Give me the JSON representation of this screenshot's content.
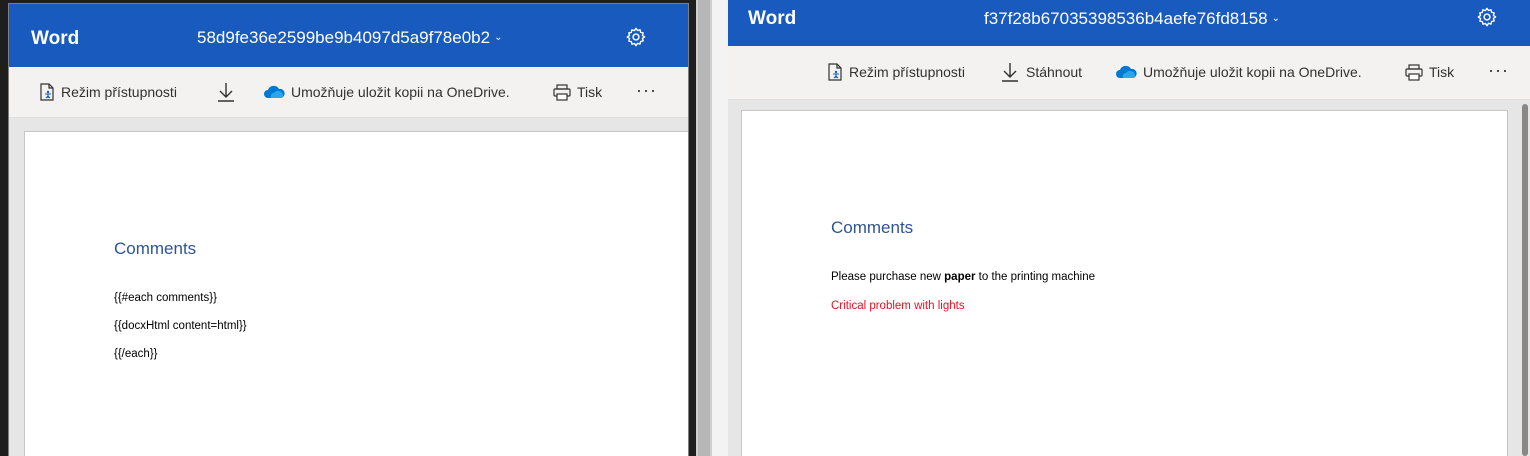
{
  "left": {
    "app_name": "Word",
    "doc_title": "58d9fe36e2599be9b4097d5a9f78e0b2",
    "toolbar": {
      "accessibility_label": "Režim přístupnosti",
      "onedrive_label": "Umožňuje uložit kopii na OneDrive.",
      "print_label": "Tisk",
      "more_label": "···"
    },
    "document": {
      "heading": "Comments",
      "lines": [
        "{{#each comments}}",
        "{{docxHtml content=html}}",
        "{{/each}}"
      ]
    }
  },
  "right": {
    "app_name": "Word",
    "doc_title": "f37f28b67035398536b4aefe76fd8158",
    "toolbar": {
      "accessibility_label": "Režim přístupnosti",
      "download_label": "Stáhnout",
      "onedrive_label": "Umožňuje uložit kopii na OneDrive.",
      "print_label": "Tisk",
      "more_label": "···"
    },
    "document": {
      "heading": "Comments",
      "comment1_before": "Please purchase new ",
      "comment1_bold": "paper",
      "comment1_after": " to the printing machine",
      "comment2": "Critical problem with lights",
      "comment2_color": "#e81123"
    }
  },
  "colors": {
    "titlebar": "#185abd",
    "toolbar": "#f3f2f1",
    "heading": "#2f5496"
  }
}
